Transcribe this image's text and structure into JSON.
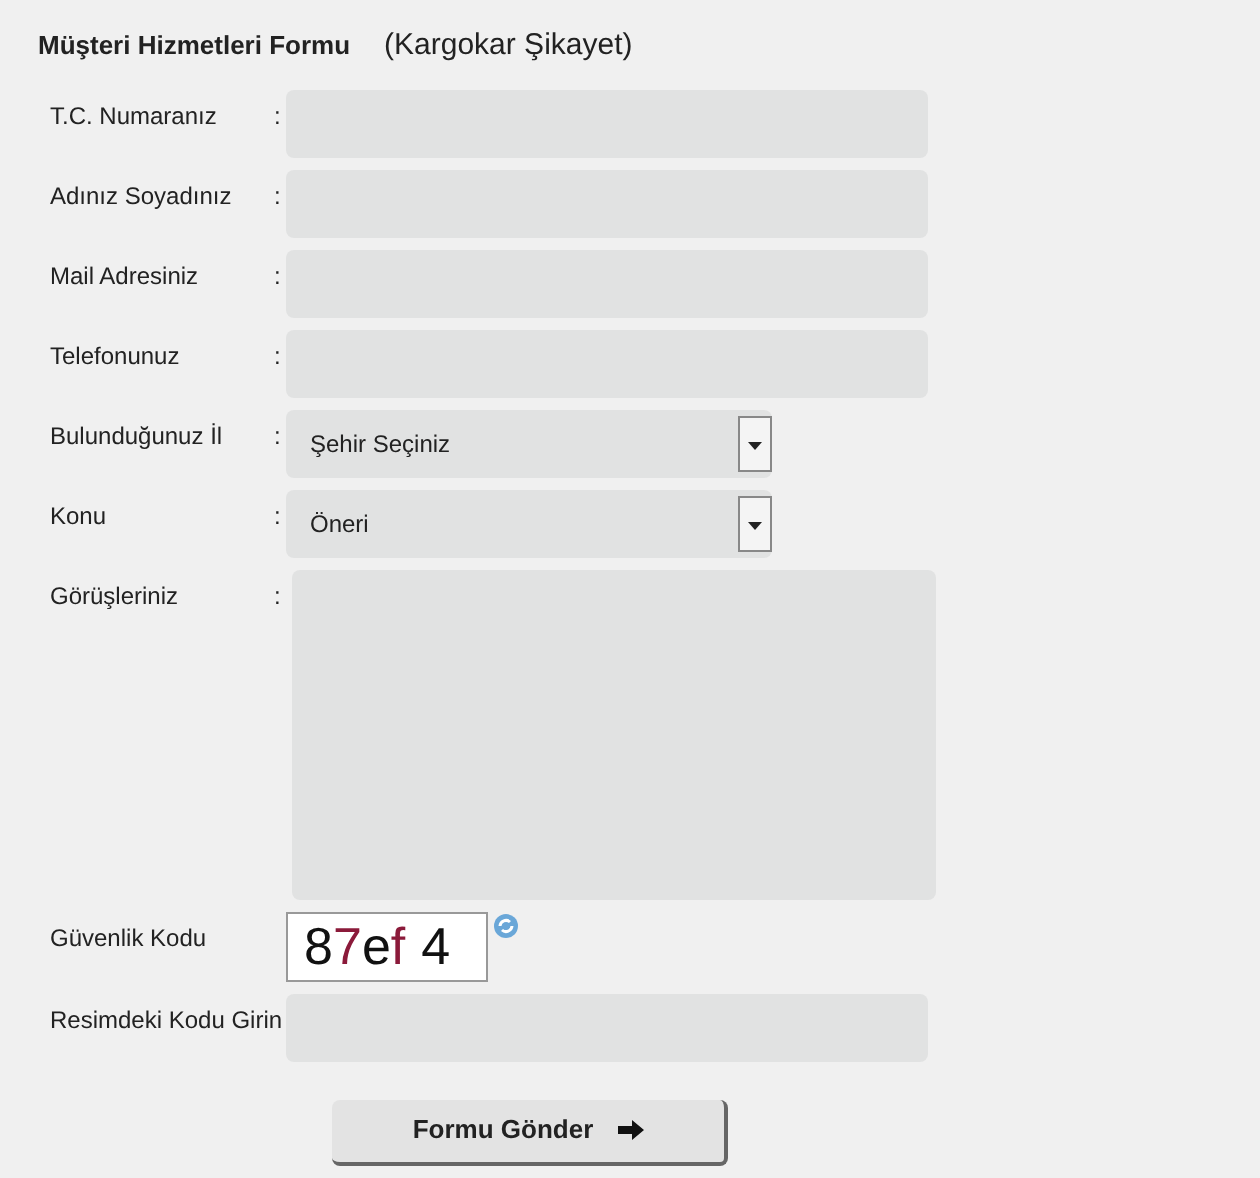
{
  "title": "Müşteri Hizmetleri Formu",
  "subtitle": "(Kargokar Şikayet)",
  "rows": [
    {
      "kind": "text",
      "label": "T.C. Numaranız",
      "colon": ":"
    },
    {
      "kind": "text",
      "label": "Adınız Soyadınız",
      "colon": ":"
    },
    {
      "kind": "text",
      "label": "Mail Adresiniz",
      "colon": ":"
    },
    {
      "kind": "text",
      "label": "Telefonunuz",
      "colon": ":"
    },
    {
      "kind": "select",
      "label": "Bulunduğunuz İl",
      "colon": ":",
      "value": "Şehir Seçiniz"
    },
    {
      "kind": "select",
      "label": "Konu",
      "colon": ":",
      "value": "Öneri"
    },
    {
      "kind": "textarea",
      "label": "Görüşleriniz",
      "colon": ":"
    },
    {
      "kind": "captcha",
      "label": "Güvenlik Kodu",
      "chars": [
        {
          "text": "8",
          "color": "#111111"
        },
        {
          "text": "7",
          "color": "#8b1a3a"
        },
        {
          "text": "e",
          "color": "#111111"
        },
        {
          "text": "f",
          "color": "#8b1a3a"
        },
        {
          "text": "4",
          "color": "#111111"
        }
      ]
    },
    {
      "kind": "text",
      "label": "Resimdeki Kodu Girin"
    }
  ],
  "submit": "Formu Gönder"
}
